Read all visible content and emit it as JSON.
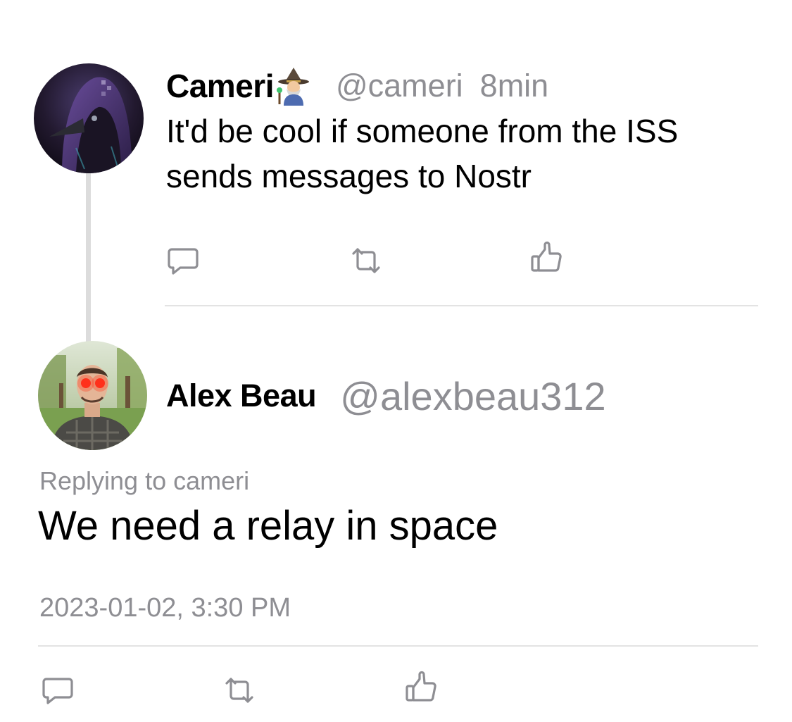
{
  "parent_note": {
    "display_name": "Cameri",
    "name_emoji": "wizard-emoji",
    "handle": "@cameri",
    "time_ago": "8min",
    "content": "It'd be cool if someone from the ISS sends messages to Nostr",
    "actions": [
      "reply-icon",
      "repost-icon",
      "like-icon"
    ]
  },
  "reply_note": {
    "display_name": "Alex Beau",
    "handle": "@alexbeau312",
    "replying_to": "Replying to cameri",
    "content": "We need a relay in space",
    "timestamp": "2023-01-02, 3:30 PM",
    "actions": [
      "reply-icon",
      "repost-icon",
      "like-icon"
    ]
  },
  "colors": {
    "text": "#000000",
    "secondary_text": "#8e8e93",
    "divider": "#e3e3e3",
    "thread_line": "#dcdcdc",
    "icon": "#8e8e93"
  }
}
